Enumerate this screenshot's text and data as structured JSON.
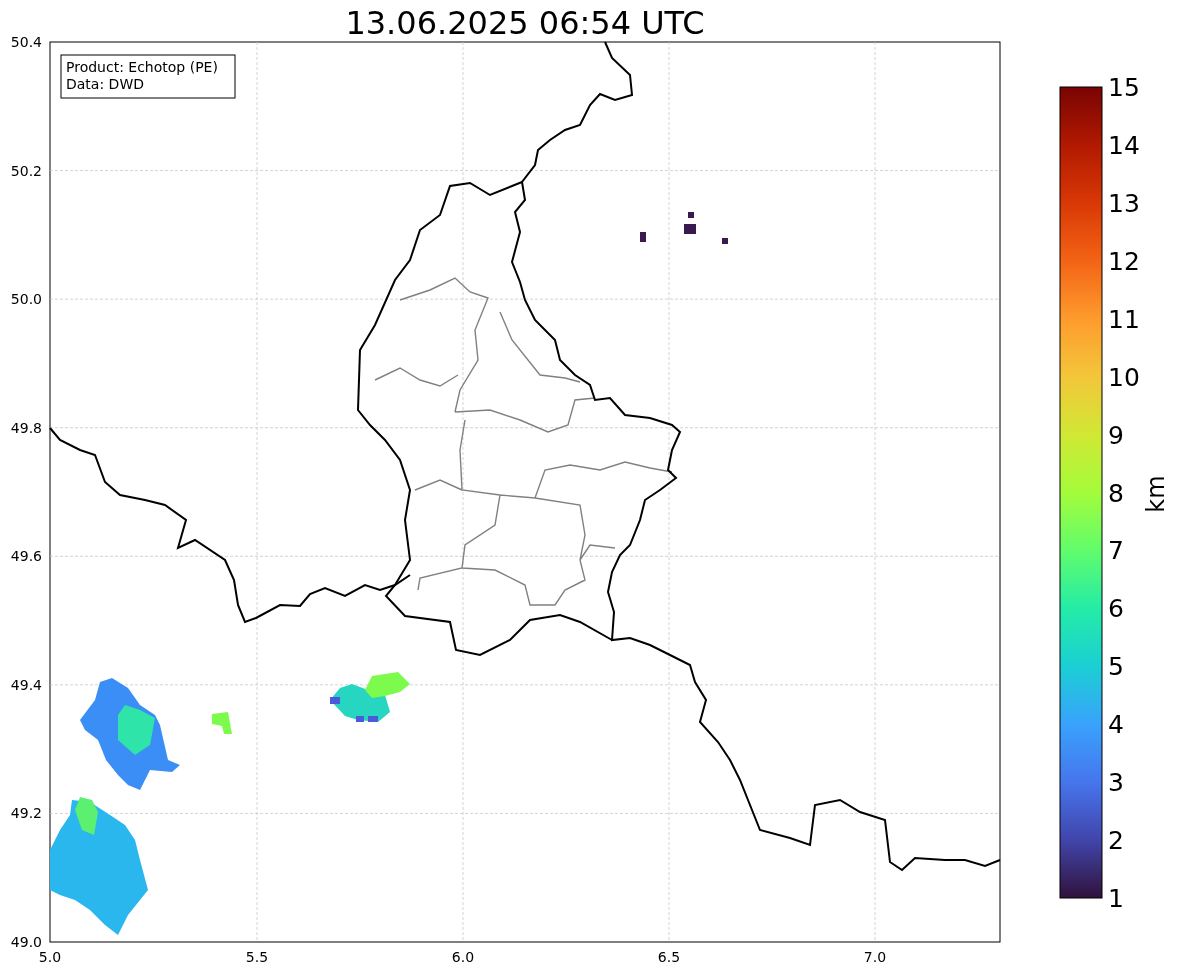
{
  "title": "13.06.2025 06:54 UTC",
  "info_box": {
    "lines": [
      "Product: Echotop (PE)",
      "Data: DWD"
    ]
  },
  "x_axis": {
    "ticks": [
      "5.0",
      "5.5",
      "6.0",
      "6.5",
      "7.0"
    ]
  },
  "y_axis": {
    "ticks": [
      "50.4",
      "50.2",
      "50.0",
      "49.8",
      "49.6",
      "49.4",
      "49.2",
      "49.0"
    ]
  },
  "colorbar": {
    "label": "km",
    "ticks": [
      "15",
      "14",
      "13",
      "12",
      "11",
      "10",
      "9",
      "8",
      "7",
      "6",
      "5",
      "4",
      "3",
      "2",
      "1"
    ]
  }
}
